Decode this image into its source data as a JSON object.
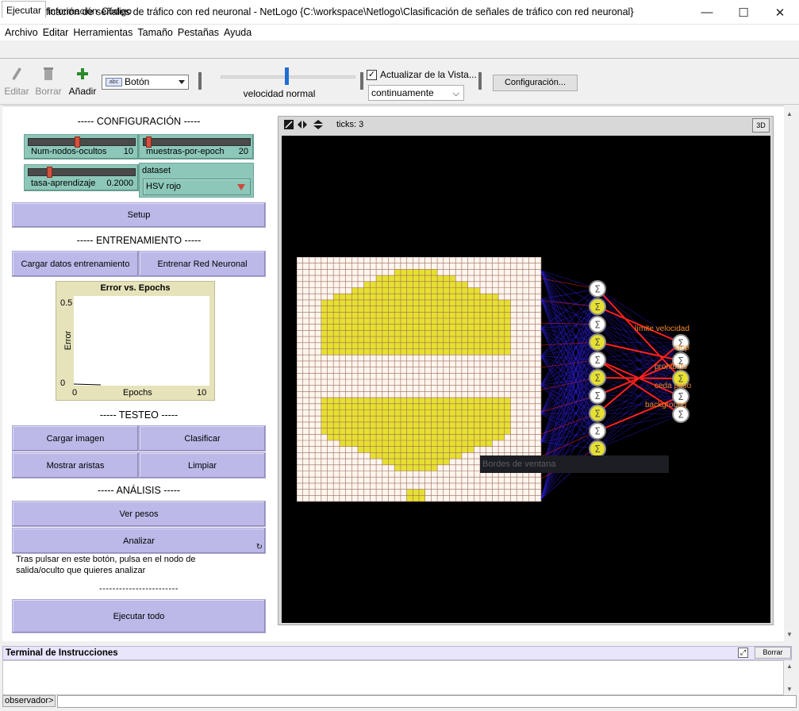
{
  "window": {
    "title": "Clasificación de señales de tráfico con red neuronal - NetLogo {C:\\workspace\\Netlogo\\Clasificación de señales de tráfico con red neuronal}",
    "minimize": "—",
    "maximize": "☐",
    "close": "✕"
  },
  "menu": [
    "Archivo",
    "Editar",
    "Herramientas",
    "Tamaño",
    "Pestañas",
    "Ayuda"
  ],
  "tabs": [
    "Ejecutar",
    "Información",
    "Código"
  ],
  "toolbar": {
    "edit_label": "Editar",
    "delete_label": "Borrar",
    "add_label": "Añadir",
    "widget_type": "Botón",
    "widget_icon_text": "abc",
    "speed_label": "velocidad normal",
    "speed_value": 0.5,
    "update_view_label": "Actualizar de la Vista...",
    "update_view_checked": true,
    "update_mode": "continuamente",
    "settings_label": "Configuración..."
  },
  "interface": {
    "config_heading": "----- CONFIGURACIÓN -----",
    "sliders": [
      {
        "name": "Num-nodos-ocultos",
        "value": "10",
        "fraction": 0.45
      },
      {
        "name": "muestras-por-epoch",
        "value": "20",
        "fraction": 0.02
      },
      {
        "name": "tasa-aprendizaje",
        "value": "0.2000",
        "fraction": 0.18
      }
    ],
    "dataset": {
      "name": "dataset",
      "selected": "HSV rojo"
    },
    "setup_button": "Setup",
    "training_heading": "----- ENTRENAMIENTO -----",
    "load_training_button": "Cargar datos entrenamiento",
    "train_button": "Entrenar Red Neuronal",
    "plot": {
      "title": "Error vs. Epochs",
      "y_label": "Error",
      "x_label": "Epochs",
      "y_max": "0.5",
      "y_min": "0",
      "x_min": "0",
      "x_max": "10"
    },
    "test_heading": "----- TESTEO -----",
    "load_image_button": "Cargar imagen",
    "classify_button": "Clasificar",
    "show_edges_button": "Mostrar aristas",
    "clear_button": "Limpiar",
    "analysis_heading": "----- ANÁLISIS -----",
    "weights_button": "Ver pesos",
    "analyze_button": "Analizar",
    "analyze_note": "Tras pulsar en este botón, pulsa en el nodo de salida/oculto que quieres analizar",
    "divider": "------------------------",
    "run_all_button": "Ejecutar todo"
  },
  "view": {
    "ticks": "ticks: 3",
    "three_d": "3D",
    "output_labels": [
      "límite velocidad",
      "stop",
      "prohibido",
      "ceda paso",
      "background"
    ],
    "tooltip": "Bordes de ventana",
    "node_symbol": "Σ",
    "colors": {
      "sign_yellow": "#e6e030",
      "grid_bg": "#fdf5ee",
      "grid_line": "#9c6a5a",
      "label_orange": "#f08a26",
      "edge_red": "#ff2020",
      "edge_blue": "#2a1dd8"
    }
  },
  "command_center": {
    "title": "Terminal de Instrucciones",
    "clear_label": "Borrar",
    "observer_label": "observador>",
    "input_value": ""
  }
}
